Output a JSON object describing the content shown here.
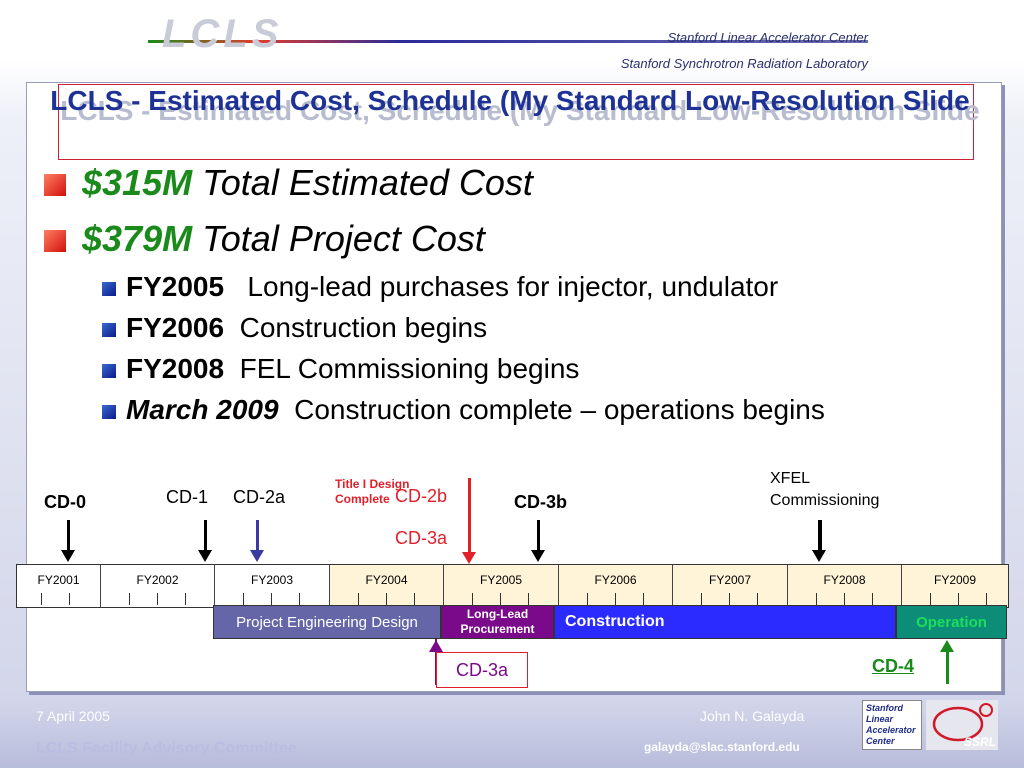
{
  "header": {
    "logo": "LCLS",
    "org_line1": "Stanford Linear Accelerator Center",
    "org_line2": "Stanford Synchrotron Radiation Laboratory"
  },
  "title": "LCLS - Estimated Cost, Schedule (My Standard Low-Resolution Slide",
  "bullets": [
    {
      "amount": "$315M",
      "text": "Total Estimated Cost"
    },
    {
      "amount": "$379M",
      "text": "Total Project Cost"
    }
  ],
  "sub_bullets": [
    {
      "key": "FY2005",
      "text": "Long-lead purchases for injector, undulator",
      "italic": false
    },
    {
      "key": "FY2006",
      "text": "Construction begins",
      "italic": false
    },
    {
      "key": "FY2008",
      "text": "FEL Commissioning begins",
      "italic": false
    },
    {
      "key": "March 2009",
      "text": "Construction complete – operations begins",
      "italic": true
    }
  ],
  "timeline": {
    "years": [
      "FY2001",
      "FY2002",
      "FY2003",
      "FY2004",
      "FY2005",
      "FY2006",
      "FY2007",
      "FY2008",
      "FY2009"
    ],
    "phases": {
      "ped": "Project Engineering Design",
      "llp": "Long-Lead Procurement",
      "construction": "Construction",
      "operation": "Operation"
    },
    "milestones": {
      "cd0": "CD-0",
      "cd1": "CD-1",
      "cd2a": "CD-2a",
      "title1": "Title I Design Complete",
      "cd2b": "CD-2b",
      "cd3a_top": "CD-3a",
      "cd3b": "CD-3b",
      "xfel": "XFEL Commissioning",
      "cd3a_bottom": "CD-3a",
      "cd4": "CD-4"
    },
    "colors": {
      "ped": "#6466a8",
      "llp": "#7a0a8a",
      "construction": "#2b2bff",
      "operation": "#0d8c78",
      "operation_text": "#19e05a",
      "red": "#e0202a",
      "blue": "#3a3aa0",
      "green": "#1a8a1a"
    }
  },
  "footer": {
    "date": "7 April 2005",
    "committee": "LCLS Facility Advisory Committee",
    "author": "John N. Galayda",
    "email": "galayda@slac.stanford.edu",
    "logo_text": "Stanford Linear Accelerator Center",
    "ssrl": "SSRL"
  }
}
